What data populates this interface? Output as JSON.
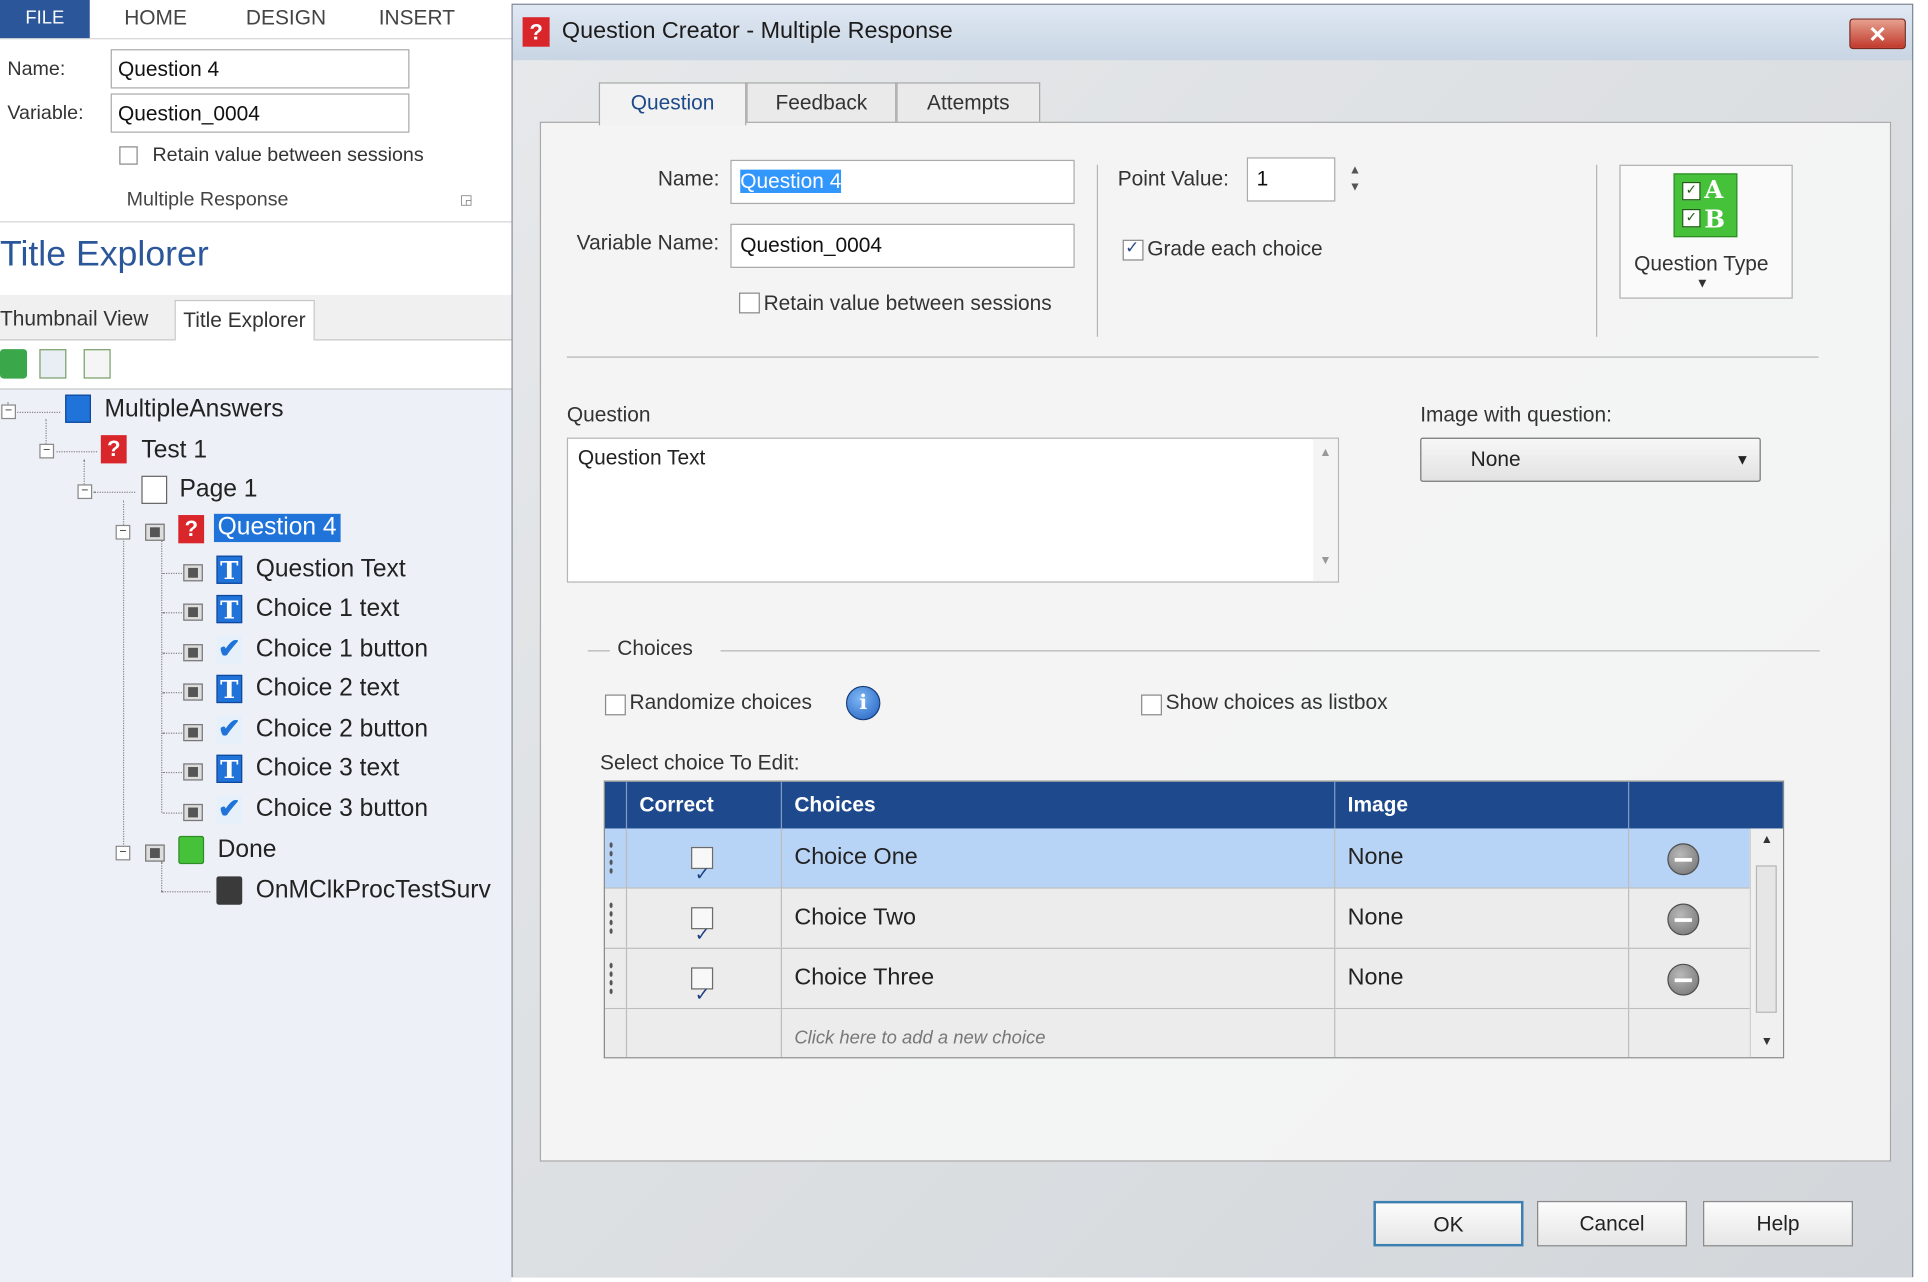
{
  "ribbon": {
    "tabs": [
      "FILE",
      "HOME",
      "DESIGN",
      "INSERT"
    ],
    "name_label": "Name:",
    "name_value": "Question 4",
    "variable_label": "Variable:",
    "variable_value": "Question_0004",
    "retain_label": "Retain value between sessions",
    "group_label": "Multiple Response"
  },
  "explorer": {
    "title": "Title Explorer",
    "tabs": [
      "Thumbnail View",
      "Title Explorer"
    ],
    "tree": [
      "MultipleAnswers",
      "Test 1",
      "Page 1",
      "Question 4",
      "Question Text",
      "Choice 1 text",
      "Choice 1 button",
      "Choice 2 text",
      "Choice 2 button",
      "Choice 3 text",
      "Choice 3 button",
      "Done",
      "OnMClkProcTestSurv"
    ]
  },
  "dialog": {
    "title": "Question Creator - Multiple Response",
    "close_glyph": "✕",
    "tabs": [
      "Question",
      "Feedback",
      "Attempts"
    ],
    "name_label": "Name:",
    "name_value": "Question 4",
    "variable_label": "Variable Name:",
    "variable_value": "Question_0004",
    "retain_label": "Retain value between sessions",
    "point_label": "Point Value:",
    "point_value": "1",
    "grade_label": "Grade each choice",
    "qtype_label": "Question Type",
    "question_label": "Question",
    "question_text": "Question Text",
    "image_label": "Image with question:",
    "image_value": "None",
    "choices_label": "Choices",
    "randomize_label": "Randomize choices",
    "listbox_label": "Show choices as listbox",
    "select_label": "Select choice To Edit:",
    "grid_headers": [
      "Correct",
      "Choices",
      "Image"
    ],
    "rows": [
      {
        "choice": "Choice One",
        "image": "None",
        "correct": true
      },
      {
        "choice": "Choice Two",
        "image": "None",
        "correct": true
      },
      {
        "choice": "Choice Three",
        "image": "None",
        "correct": true
      }
    ],
    "add_hint": "Click here to add a new choice",
    "buttons": {
      "ok": "OK",
      "cancel": "Cancel",
      "help": "Help"
    }
  }
}
